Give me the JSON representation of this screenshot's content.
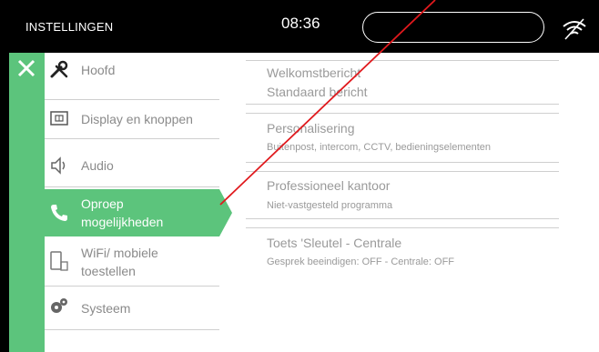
{
  "header": {
    "title": "INSTELLINGEN",
    "time": "08:36",
    "wifi_icon": "wifi-settings-icon"
  },
  "nav": {
    "items": [
      {
        "label": "Hoofd",
        "icon": "wrench-screwdriver-icon",
        "active": false
      },
      {
        "label": "Display en knoppen",
        "icon": "display-buttons-icon",
        "active": false
      },
      {
        "label": "Audio",
        "icon": "speaker-icon",
        "active": false
      },
      {
        "label_line1": "Oproep",
        "label_line2": "mogelijkheden",
        "icon": "phone-icon",
        "active": true
      },
      {
        "label_line1": "WiFi/ mobiele",
        "label_line2": "toestellen",
        "icon": "mobile-device-icon",
        "active": false
      },
      {
        "label": "Systeem",
        "icon": "gears-icon",
        "active": false
      }
    ]
  },
  "panel": {
    "sections": [
      {
        "title": "Welkomstbericht",
        "subtitle": "Standaard bericht"
      },
      {
        "title": "Personalisering",
        "subtitle": "Buitenpost, intercom, CCTV, bedieningselementen"
      },
      {
        "title": "Professioneel kantoor",
        "subtitle": "Niet-vastgesteld programma"
      },
      {
        "title": "Toets 'Sleutel - Centrale",
        "subtitle": "Gesprek beeindigen: OFF - Centrale: OFF"
      }
    ]
  },
  "colors": {
    "accent": "#5cc47c",
    "frame": "#000000",
    "text_muted": "#8a8a8a",
    "annotation": "#e0191d"
  }
}
